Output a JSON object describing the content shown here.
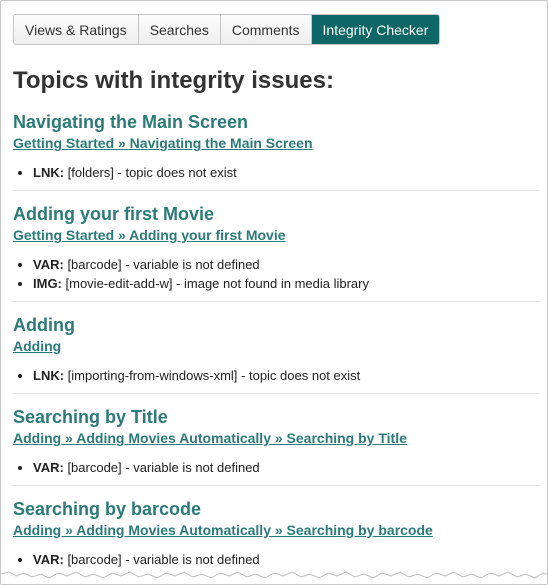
{
  "tabs": [
    {
      "label": "Views & Ratings",
      "active": false
    },
    {
      "label": "Searches",
      "active": false
    },
    {
      "label": "Comments",
      "active": false
    },
    {
      "label": "Integrity Checker",
      "active": true
    }
  ],
  "page_title": "Topics with integrity issues:",
  "topics": [
    {
      "title": "Navigating the Main Screen",
      "path": "Getting Started » Navigating the Main Screen",
      "issues": [
        {
          "type": "LNK:",
          "text": "[folders] - topic does not exist"
        }
      ]
    },
    {
      "title": "Adding your first Movie",
      "path": "Getting Started » Adding your first Movie",
      "issues": [
        {
          "type": "VAR:",
          "text": "[barcode] - variable is not defined"
        },
        {
          "type": "IMG:",
          "text": "[movie-edit-add-w] - image not found in media library"
        }
      ]
    },
    {
      "title": "Adding",
      "path": "Adding",
      "issues": [
        {
          "type": "LNK:",
          "text": "[importing-from-windows-xml] - topic does not exist"
        }
      ]
    },
    {
      "title": "Searching by Title",
      "path": "Adding » Adding Movies Automatically » Searching by Title",
      "issues": [
        {
          "type": "VAR:",
          "text": "[barcode] - variable is not defined"
        }
      ]
    },
    {
      "title": "Searching by barcode",
      "path": "Adding » Adding Movies Automatically » Searching by barcode",
      "issues": [
        {
          "type": "VAR:",
          "text": "[barcode] - variable is not defined"
        }
      ]
    }
  ],
  "colors": {
    "accent": "#0e6766",
    "link": "#2a7b79"
  }
}
